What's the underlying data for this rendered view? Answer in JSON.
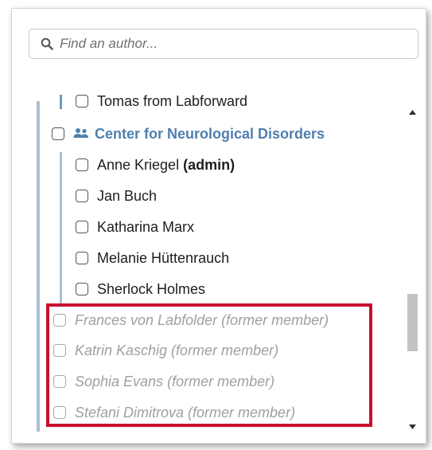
{
  "search": {
    "placeholder": "Find an author..."
  },
  "list": {
    "partial_item": "Tomas from Labforward",
    "group": {
      "label": "Center for Neurological Disorders",
      "icon": "users-icon"
    },
    "members": [
      {
        "name": "Anne Kriegel",
        "role": "(admin)"
      },
      {
        "name": "Jan Buch"
      },
      {
        "name": "Katharina Marx"
      },
      {
        "name": "Melanie Hüttenrauch"
      },
      {
        "name": "Sherlock Holmes"
      }
    ],
    "former_members": [
      {
        "label": "Frances von Labfolder (former member)"
      },
      {
        "label": "Katrin Kaschig (former member)"
      },
      {
        "label": "Sophia Evans (former member)"
      },
      {
        "label": "Stefani Dimitrova (former member)"
      }
    ]
  },
  "colors": {
    "group_label": "#4f7fae",
    "highlight_border": "#c8102e",
    "former_text": "#a0a0a0"
  }
}
